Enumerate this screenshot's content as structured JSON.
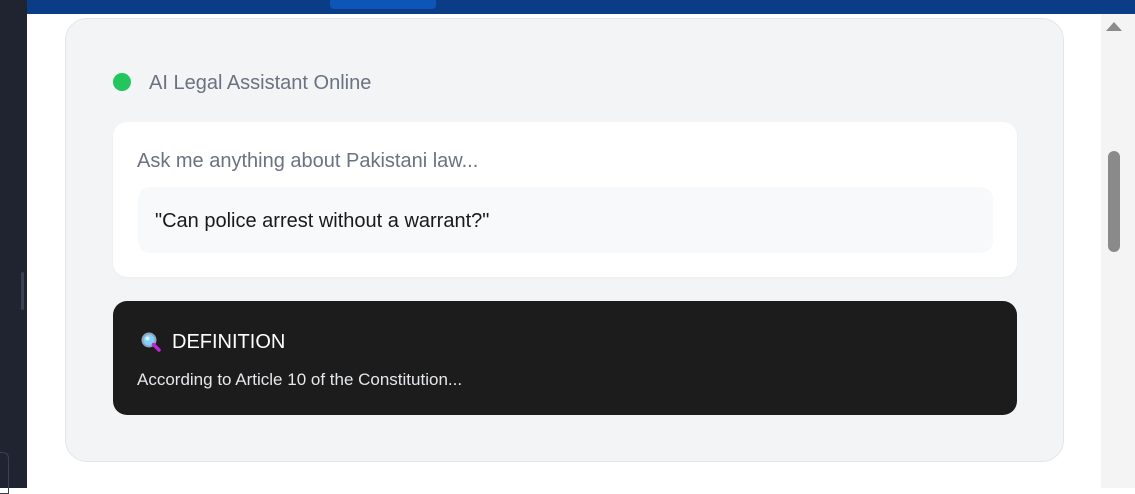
{
  "assistant": {
    "status_text": "AI Legal Assistant Online",
    "status_color": "#22c55e"
  },
  "chat_input": {
    "placeholder": "Ask me anything about Pakistani law...",
    "example_query": "\"Can police arrest without a warrant?\""
  },
  "definition": {
    "icon": "magnifying-glass-icon",
    "title": "DEFINITION",
    "body": "According to Article 10 of the Constitution..."
  },
  "colors": {
    "header_bar": "#0b3d86",
    "card_background": "#f3f4f6",
    "definition_background": "#1c1c1c"
  }
}
